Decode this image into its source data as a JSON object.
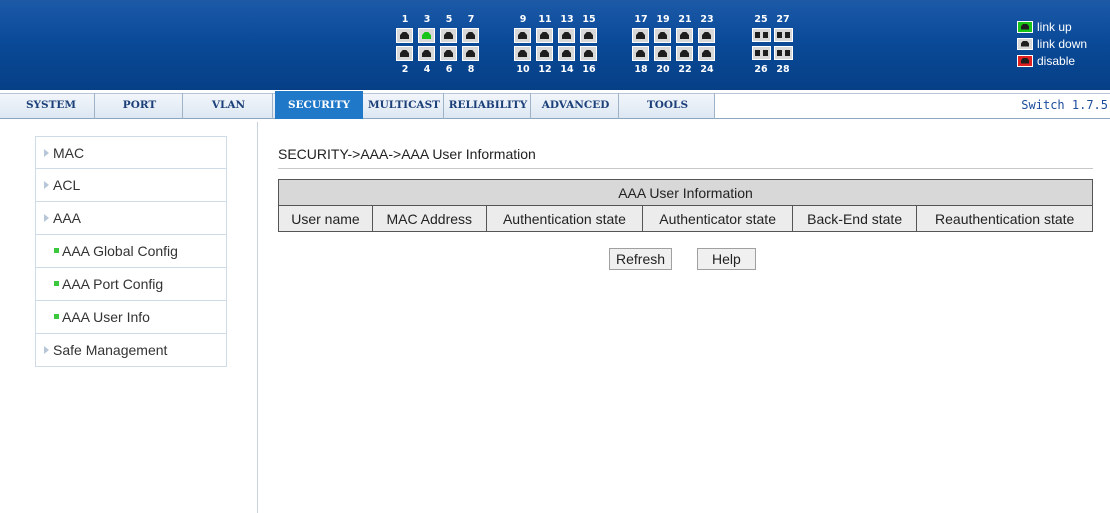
{
  "banner": {
    "groups": [
      {
        "top_labels": [
          "1",
          "3",
          "5",
          "7"
        ],
        "bottom_labels": [
          "2",
          "4",
          "6",
          "8"
        ],
        "top_states": [
          "down",
          "up",
          "down",
          "down"
        ],
        "bottom_states": [
          "down",
          "down",
          "down",
          "down"
        ]
      },
      {
        "top_labels": [
          "9",
          "11",
          "13",
          "15"
        ],
        "bottom_labels": [
          "10",
          "12",
          "14",
          "16"
        ],
        "top_states": [
          "down",
          "down",
          "down",
          "down"
        ],
        "bottom_states": [
          "down",
          "down",
          "down",
          "down"
        ]
      },
      {
        "top_labels": [
          "17",
          "19",
          "21",
          "23"
        ],
        "bottom_labels": [
          "18",
          "20",
          "22",
          "24"
        ],
        "top_states": [
          "down",
          "down",
          "down",
          "down"
        ],
        "bottom_states": [
          "down",
          "down",
          "down",
          "down"
        ]
      },
      {
        "top_labels": [
          "25",
          "27"
        ],
        "bottom_labels": [
          "26",
          "28"
        ],
        "top_states": [
          "fiber",
          "fiber"
        ],
        "bottom_states": [
          "fiber",
          "fiber"
        ]
      }
    ],
    "legend": {
      "link_up": "link up",
      "link_down": "link down",
      "disable": "disable"
    }
  },
  "nav": {
    "tabs": [
      "SYSTEM",
      "PORT",
      "VLAN",
      "SECURITY",
      "MULTICAST",
      "RELIABILITY",
      "ADVANCED",
      "TOOLS"
    ],
    "active": "SECURITY",
    "version": "Switch 1.7.5"
  },
  "sidebar": {
    "items": [
      {
        "label": "MAC",
        "kind": "section"
      },
      {
        "label": "ACL",
        "kind": "section"
      },
      {
        "label": "AAA",
        "kind": "section"
      },
      {
        "label": "AAA Global Config",
        "kind": "sub"
      },
      {
        "label": "AAA Port Config",
        "kind": "sub"
      },
      {
        "label": "AAA User Info",
        "kind": "sub"
      },
      {
        "label": "Safe Management",
        "kind": "section"
      }
    ]
  },
  "main": {
    "breadcrumb": "SECURITY->AAA->AAA User Information",
    "table": {
      "caption": "AAA User Information",
      "columns": [
        "User name",
        "MAC Address",
        "Authentication state",
        "Authenticator state",
        "Back-End state",
        "Reauthentication state"
      ],
      "rows": []
    },
    "buttons": {
      "refresh": "Refresh",
      "help": "Help"
    }
  },
  "colors": {
    "banner": "#0a4a98",
    "active_tab": "#1f78c8",
    "link_up": "#18c418",
    "disable": "#e02020"
  }
}
